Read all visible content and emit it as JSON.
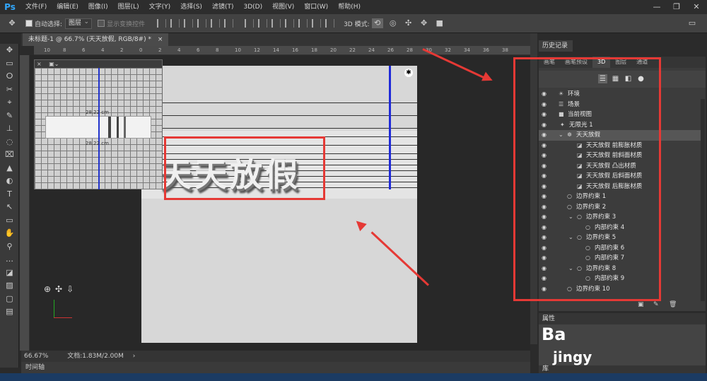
{
  "app": {
    "logo": "Ps"
  },
  "menu": [
    "文件(F)",
    "编辑(E)",
    "图像(I)",
    "图层(L)",
    "文字(Y)",
    "选择(S)",
    "滤镜(T)",
    "3D(D)",
    "视图(V)",
    "窗口(W)",
    "帮助(H)"
  ],
  "window_controls": [
    "—",
    "❐",
    "✕"
  ],
  "options": {
    "auto_select_label": "自动选择:",
    "auto_select_value": "图层",
    "transform_label": "显示变换控件",
    "mode_label": "3D 模式:"
  },
  "document": {
    "tab_title": "未标题-1 @ 66.7% (天天放假, RGB/8#) *",
    "close_glyph": "×",
    "ruler_ticks": [
      "10",
      "8",
      "6",
      "4",
      "2",
      "0",
      "2",
      "4",
      "6",
      "8",
      "10",
      "12",
      "14",
      "16",
      "18",
      "20",
      "22",
      "24",
      "26",
      "28",
      "30",
      "32",
      "34",
      "36",
      "38"
    ],
    "word": "天天放假",
    "preview_label": "28.22 cm"
  },
  "status": {
    "zoom": "66.67%",
    "doc_size": "文档:1.83M/2.00M"
  },
  "timeline_label": "时间轴",
  "history_tab": "历史记录",
  "panel": {
    "tabs": [
      "画笔",
      "画笔预设",
      "3D",
      "图层",
      "通道"
    ],
    "active_tab": "3D",
    "layers": [
      {
        "name": "环境"
      },
      {
        "name": "场景"
      },
      {
        "name": "当前视图"
      },
      {
        "name": "无限光 1"
      },
      {
        "name": "天天放假"
      },
      {
        "name": "天天放假 前膨胀材质"
      },
      {
        "name": "天天放假 前斜面材质"
      },
      {
        "name": "天天放假 凸出材质"
      },
      {
        "name": "天天放假 后斜面材质"
      },
      {
        "name": "天天放假 后膨胀材质"
      },
      {
        "name": "边界约束 1"
      },
      {
        "name": "边界约束 2"
      },
      {
        "name": "边界约束 3"
      },
      {
        "name": "内部约束 4"
      },
      {
        "name": "边界约束 5"
      },
      {
        "name": "内部约束 6"
      },
      {
        "name": "内部约束 7"
      },
      {
        "name": "边界约束 8"
      },
      {
        "name": "内部约束 9"
      },
      {
        "name": "边界约束 10"
      }
    ]
  },
  "properties_tab": "属性",
  "library_tab": "库",
  "watermark": {
    "line1": "Ba",
    "line2": "jingy"
  },
  "colors": {
    "highlight": "#e53935",
    "axis": "#1f2ad8"
  }
}
